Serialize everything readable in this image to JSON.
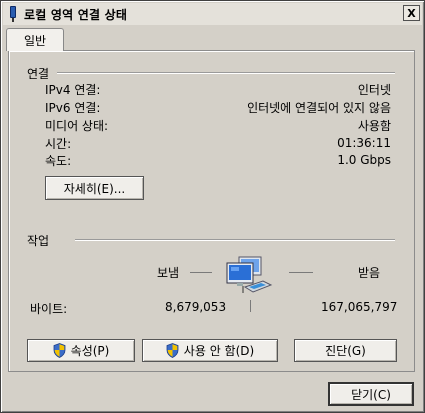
{
  "window": {
    "title": "로컬 영역 연결 상태",
    "close_label": "X"
  },
  "tabs": [
    {
      "label": "일반"
    }
  ],
  "connection": {
    "section_title": "연결",
    "rows": [
      {
        "label": "IPv4 연결:",
        "value": "인터넷"
      },
      {
        "label": "IPv6 연결:",
        "value": "인터넷에 연결되어 있지 않음"
      },
      {
        "label": "미디어 상태:",
        "value": "사용함"
      },
      {
        "label": "시간:",
        "value": "01:36:11"
      },
      {
        "label": "속도:",
        "value": "1.0 Gbps"
      }
    ],
    "details_button": "자세히(E)..."
  },
  "activity": {
    "section_title": "작업",
    "sent_label": "보냄",
    "received_label": "받음",
    "bytes_label": "바이트:",
    "sent_bytes": "8,679,053",
    "received_bytes": "167,065,797",
    "icon": "network-computers-icon"
  },
  "buttons": {
    "properties": "속성(P)",
    "disable": "사용 안 함(D)",
    "diagnose": "진단(G)",
    "close": "닫기(C)"
  },
  "colors": {
    "window_bg": "#d4d0c8",
    "monitor_blue": "#2a6fd6",
    "shield_blue": "#3a6cc8",
    "shield_yellow": "#f2c200"
  }
}
